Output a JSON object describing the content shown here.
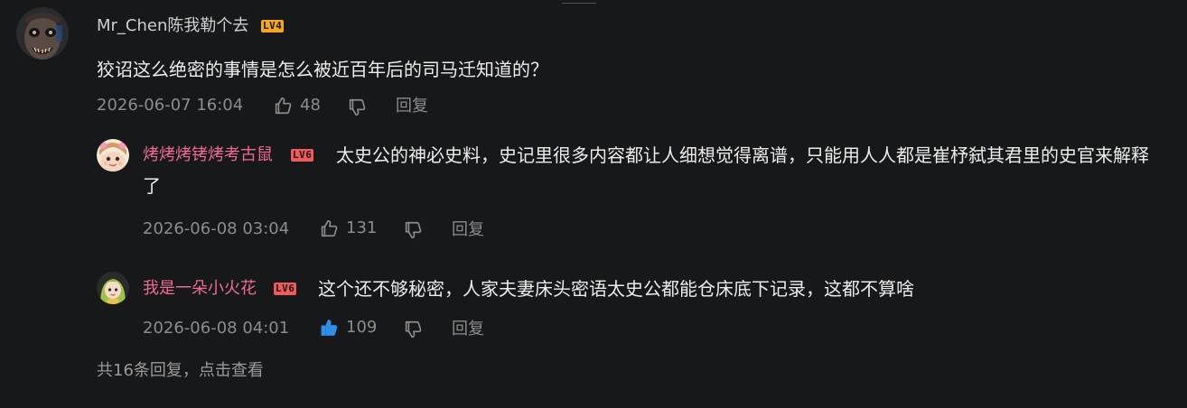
{
  "main_comment": {
    "username": "Mr_Chen陈我勒个去",
    "level": "LV4",
    "text": "狡诏这么绝密的事情是怎么被近百年后的司马迁知道的？",
    "timestamp": "2026-06-07 16:04",
    "likes": "48",
    "reply_label": "回复"
  },
  "replies": [
    {
      "username": "烤烤烤铐烤考古鼠",
      "level": "LV6",
      "text": "太史公的神必史料，史记里很多内容都让人细想觉得离谱，只能用人人都是崔杼弑其君里的史官来解释了",
      "timestamp": "2026-06-08 03:04",
      "likes": "131",
      "reply_label": "回复",
      "liked": false
    },
    {
      "username": "我是一朵小火花",
      "level": "LV6",
      "text": "这个还不够秘密，人家夫妻床头密语太史公都能仓床底下记录，这都不算啥",
      "timestamp": "2026-06-08 04:01",
      "likes": "109",
      "reply_label": "回复",
      "liked": true
    }
  ],
  "more_replies": "共16条回复，点击查看",
  "colors": {
    "background": "#17181a",
    "pink_username": "#f06a92",
    "liked_blue": "#2f8fe8",
    "meta_gray": "#8c8c8c"
  },
  "icons": [
    "thumbs-up-icon",
    "thumbs-down-icon"
  ]
}
